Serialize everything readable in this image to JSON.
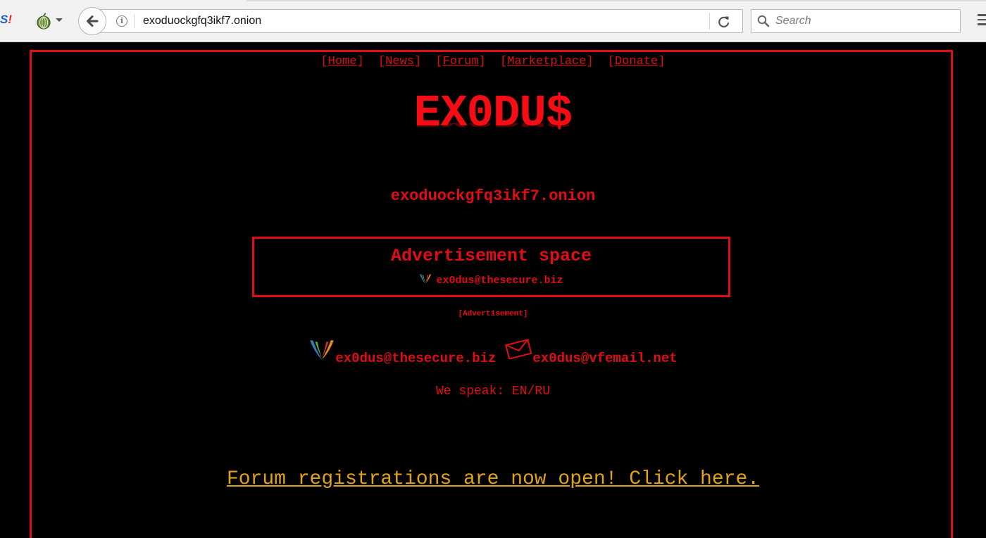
{
  "browser": {
    "url": "exoduockgfq3ikf7.onion",
    "search_placeholder": "Search",
    "extension_label": "S",
    "extension_bang": "!"
  },
  "nav": {
    "items": [
      {
        "label": "Home"
      },
      {
        "label": "News"
      },
      {
        "label": "Forum"
      },
      {
        "label": "Marketplace"
      },
      {
        "label": "Donate"
      }
    ],
    "open_bracket": "[",
    "close_bracket": "]"
  },
  "site": {
    "logo": "EX0DU$",
    "onion_address": "exoduockgfq3ikf7.onion"
  },
  "ad": {
    "title": "Advertisement space",
    "contact": "ex0dus@thesecure.biz",
    "label": "[Advertisement]"
  },
  "contacts": {
    "xmpp": "ex0dus@thesecure.biz",
    "email": "ex0dus@vfemail.net"
  },
  "languages": "We speak: EN/RU",
  "forum_notice": "Forum registrations are now open! Click here.",
  "colors": {
    "accent_red": "#e00d17",
    "link_gold": "#e0a21a",
    "background": "#000000"
  }
}
